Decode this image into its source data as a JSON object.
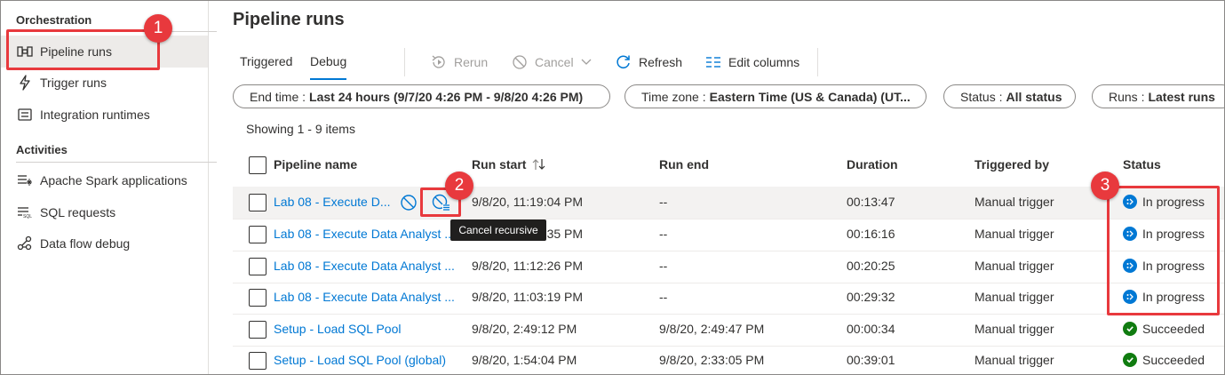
{
  "sidebar": {
    "sections": [
      {
        "title": "Orchestration"
      },
      {
        "title": "Activities"
      }
    ],
    "items": [
      {
        "label": "Pipeline runs",
        "icon": "pipeline-icon"
      },
      {
        "label": "Trigger runs",
        "icon": "lightning-icon"
      },
      {
        "label": "Integration runtimes",
        "icon": "integration-runtime-icon"
      },
      {
        "label": "Apache Spark applications",
        "icon": "spark-list-icon"
      },
      {
        "label": "SQL requests",
        "icon": "sql-list-icon"
      },
      {
        "label": "Data flow debug",
        "icon": "data-flow-icon"
      }
    ]
  },
  "page": {
    "title": "Pipeline runs"
  },
  "tabs": [
    {
      "label": "Triggered"
    },
    {
      "label": "Debug",
      "active": true
    }
  ],
  "toolbar": {
    "rerun": "Rerun",
    "cancel": "Cancel",
    "refresh": "Refresh",
    "edit_columns": "Edit columns"
  },
  "filters": [
    {
      "label": "End time :",
      "value": "Last 24 hours (9/7/20 4:26 PM - 9/8/20 4:26 PM)"
    },
    {
      "label": "Time zone :",
      "value": "Eastern Time (US & Canada) (UT..."
    },
    {
      "label": "Status :",
      "value": "All status"
    },
    {
      "label": "Runs :",
      "value": "Latest runs"
    }
  ],
  "showing": "Showing 1 - 9 items",
  "columns": [
    "Pipeline name",
    "Run start",
    "Run end",
    "Duration",
    "Triggered by",
    "Status"
  ],
  "rows": [
    {
      "name": "Lab 08 - Execute D...",
      "run_start": "9/8/20, 11:19:04 PM",
      "run_end": "--",
      "duration": "00:13:47",
      "triggered_by": "Manual trigger",
      "status": "In progress"
    },
    {
      "name": "Lab 08 - Execute Data Analyst ...",
      "run_start": "9/8/20, 11:14:35 PM",
      "run_end": "--",
      "duration": "00:16:16",
      "triggered_by": "Manual trigger",
      "status": "In progress"
    },
    {
      "name": "Lab 08 - Execute Data Analyst ...",
      "run_start": "9/8/20, 11:12:26 PM",
      "run_end": "--",
      "duration": "00:20:25",
      "triggered_by": "Manual trigger",
      "status": "In progress"
    },
    {
      "name": "Lab 08 - Execute Data Analyst ...",
      "run_start": "9/8/20, 11:03:19 PM",
      "run_end": "--",
      "duration": "00:29:32",
      "triggered_by": "Manual trigger",
      "status": "In progress"
    },
    {
      "name": "Setup - Load SQL Pool",
      "run_start": "9/8/20, 2:49:12 PM",
      "run_end": "9/8/20, 2:49:47 PM",
      "duration": "00:00:34",
      "triggered_by": "Manual trigger",
      "status": "Succeeded"
    },
    {
      "name": "Setup - Load SQL Pool (global)",
      "run_start": "9/8/20, 1:54:04 PM",
      "run_end": "9/8/20, 2:33:05 PM",
      "duration": "00:39:01",
      "triggered_by": "Manual trigger",
      "status": "Succeeded"
    }
  ],
  "tooltip": "Cancel recursive",
  "annotations": [
    "1",
    "2",
    "3"
  ],
  "colors": {
    "accent": "#0078d4",
    "annotation": "#e8393d",
    "success": "#107c10",
    "in_progress": "#0078d4"
  }
}
